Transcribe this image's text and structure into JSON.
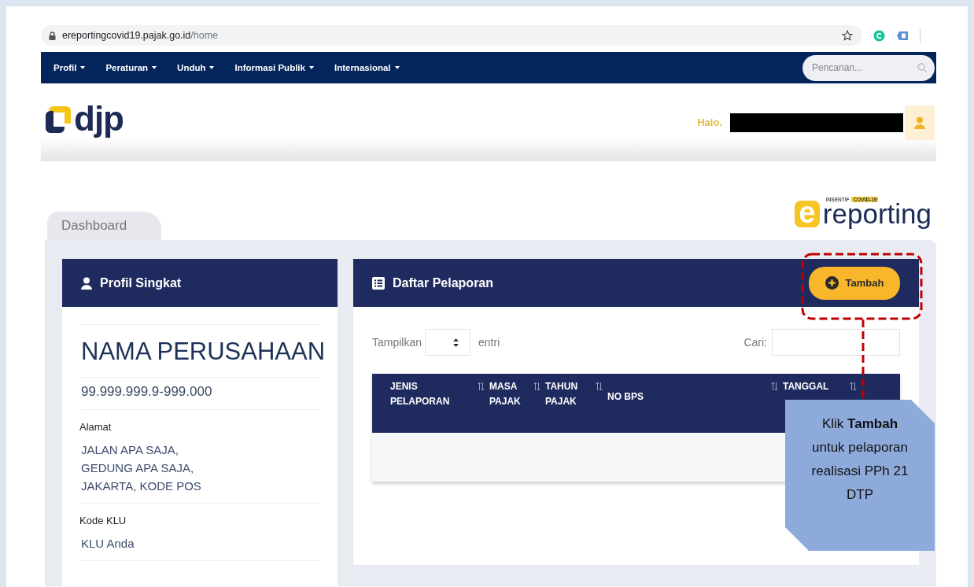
{
  "browser": {
    "url_host": "ereportingcovid19.pajak.go.id",
    "url_path": "/home"
  },
  "nav": {
    "items": [
      {
        "label": "Profil"
      },
      {
        "label": "Peraturan"
      },
      {
        "label": "Unduh"
      },
      {
        "label": "Informasi Publik"
      },
      {
        "label": "Internasional"
      }
    ],
    "search": {
      "placeholder": "Pencarian..."
    }
  },
  "header": {
    "logo": "djp",
    "greeting": "Halo."
  },
  "brand": {
    "mark": "e",
    "tag": "INSENTIF",
    "badge": "COVID-19",
    "name": "reporting"
  },
  "tabs": [
    {
      "label": "Dashboard",
      "selected": true
    }
  ],
  "profile": {
    "title": "Profil Singkat",
    "company": "NAMA PERUSAHAAN",
    "npwp": "99.999.999.9-999.000",
    "fields": [
      {
        "label": "Alamat",
        "lines": [
          "JALAN APA SAJA,",
          "GEDUNG APA SAJA,",
          "JAKARTA, KODE POS"
        ]
      },
      {
        "label": "Kode KLU",
        "lines": [
          "KLU Anda"
        ]
      }
    ]
  },
  "reports": {
    "title": "Daftar Pelaporan",
    "add_button": "Tambah",
    "length_label": "Tampilkan",
    "length_suffix": "entri",
    "search_label": "Cari:",
    "columns": [
      {
        "lines": [
          "JENIS",
          "PELAPORAN"
        ]
      },
      {
        "lines": [
          "MASA",
          "PAJAK"
        ]
      },
      {
        "lines": [
          "TAHUN",
          "PAJAK"
        ]
      },
      {
        "lines": [
          "NO BPS"
        ]
      },
      {
        "lines": [
          "TANGGAL"
        ],
        "kind": "partial"
      }
    ]
  },
  "callout": {
    "text": "Klik **Tambah** untuk pelaporan realisasi PPh 21 DTP"
  }
}
